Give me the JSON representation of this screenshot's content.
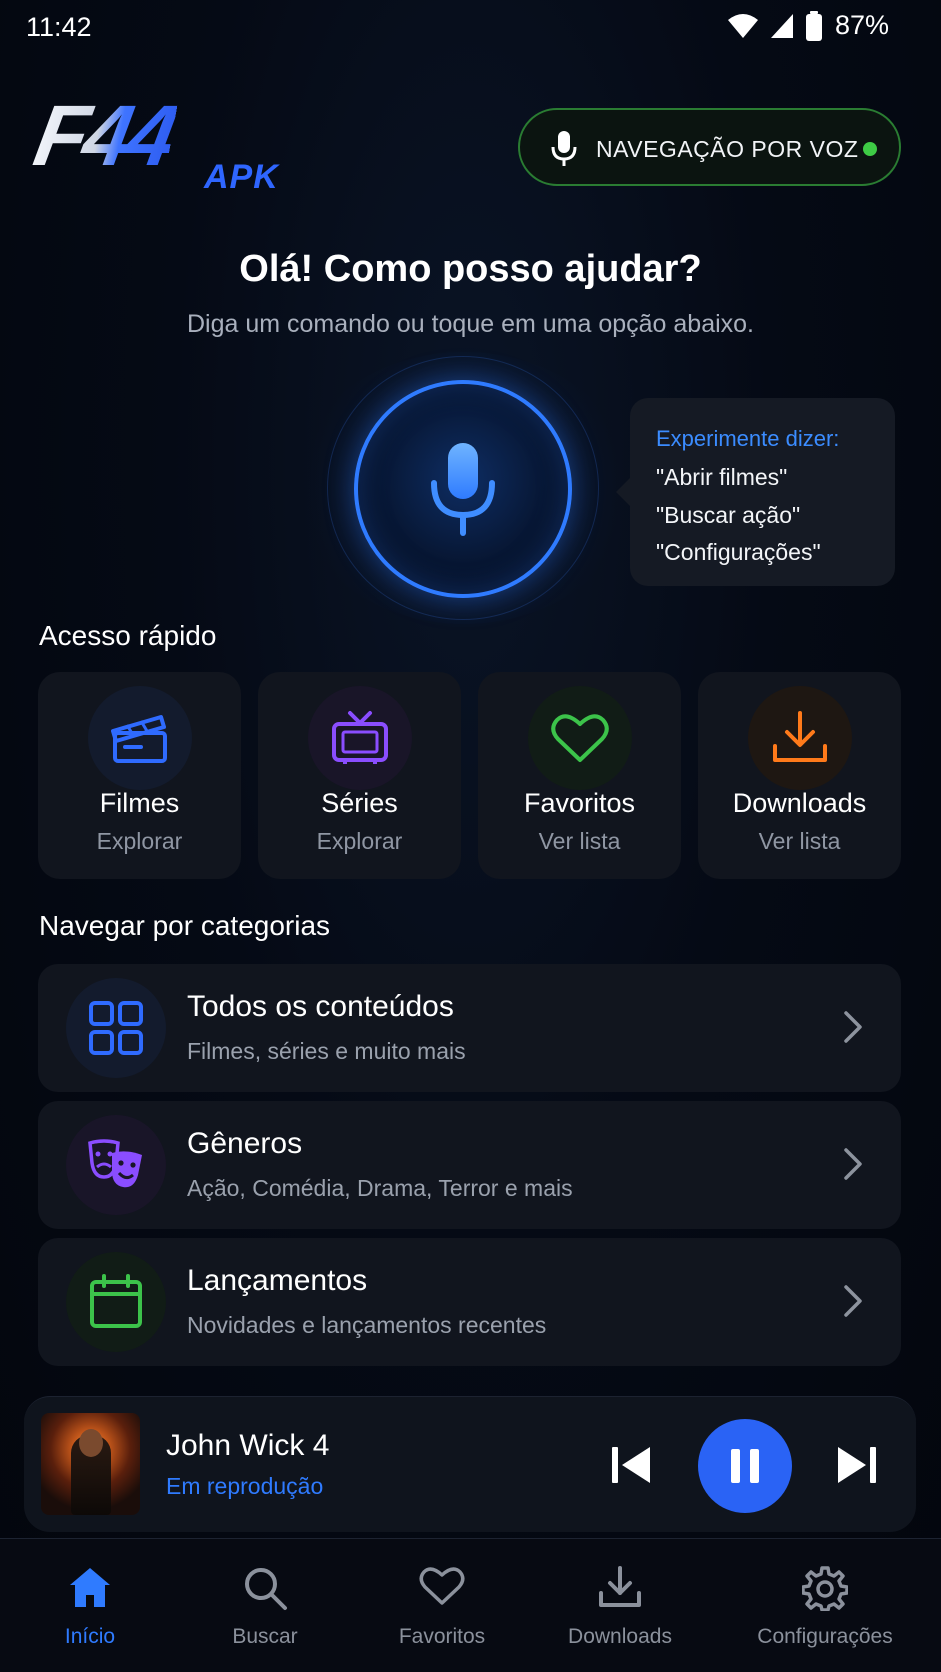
{
  "status_bar": {
    "time": "11:42",
    "battery": "87%"
  },
  "header": {
    "logo_main": "F44",
    "logo_sub": "APK",
    "voice_nav_label": "NAVEGAÇÃO POR VOZ",
    "voice_status_color": "#3ecb45"
  },
  "greeting": {
    "title": "Olá! Como posso ajudar?",
    "subtitle": "Diga um comando ou toque em uma opção abaixo."
  },
  "voice_tip": {
    "title": "Experimente dizer:",
    "examples": [
      "\"Abrir filmes\"",
      "\"Buscar ação\"",
      "\"Configurações\""
    ]
  },
  "quick_access": {
    "title": "Acesso rápido",
    "items": [
      {
        "label": "Filmes",
        "sub": "Explorar",
        "icon": "clapperboard-icon",
        "color": "#2f6bff"
      },
      {
        "label": "Séries",
        "sub": "Explorar",
        "icon": "tv-icon",
        "color": "#8a4dff"
      },
      {
        "label": "Favoritos",
        "sub": "Ver lista",
        "icon": "heart-icon",
        "color": "#3cc34a"
      },
      {
        "label": "Downloads",
        "sub": "Ver lista",
        "icon": "download-icon",
        "color": "#ff7a1a"
      }
    ]
  },
  "categories": {
    "title": "Navegar por categorias",
    "items": [
      {
        "title": "Todos os conteúdos",
        "sub": "Filmes, séries e muito mais",
        "icon": "grid-icon",
        "color": "#2f6bff"
      },
      {
        "title": "Gêneros",
        "sub": "Ação, Comédia, Drama, Terror e mais",
        "icon": "theater-masks-icon",
        "color": "#8a4dff"
      },
      {
        "title": "Lançamentos",
        "sub": "Novidades e lançamentos recentes",
        "icon": "calendar-icon",
        "color": "#3cc34a"
      }
    ]
  },
  "player": {
    "title": "John Wick 4",
    "status": "Em reprodução"
  },
  "bottom_nav": {
    "items": [
      {
        "label": "Início",
        "icon": "home-icon",
        "active": true
      },
      {
        "label": "Buscar",
        "icon": "search-icon",
        "active": false
      },
      {
        "label": "Favoritos",
        "icon": "heart-icon",
        "active": false
      },
      {
        "label": "Downloads",
        "icon": "download-icon",
        "active": false
      },
      {
        "label": "Configurações",
        "icon": "gear-icon",
        "active": false
      }
    ]
  },
  "colors": {
    "accent": "#2f7bff",
    "background": "#04070f",
    "card": "#11151e"
  }
}
